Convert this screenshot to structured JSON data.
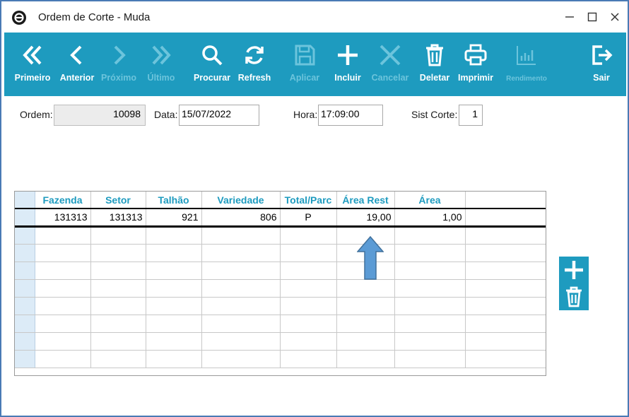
{
  "window": {
    "title": "Ordem de Corte - Muda",
    "controls": [
      "minimize-icon",
      "maximize-icon",
      "close-icon"
    ]
  },
  "toolbar": {
    "buttons": [
      {
        "label": "Primeiro",
        "icon": "first-icon",
        "enabled": true
      },
      {
        "label": "Anterior",
        "icon": "prev-icon",
        "enabled": true
      },
      {
        "label": "Próximo",
        "icon": "next-icon",
        "enabled": false
      },
      {
        "label": "Último",
        "icon": "last-icon",
        "enabled": false
      },
      {
        "label": "Procurar",
        "icon": "search-icon",
        "enabled": true
      },
      {
        "label": "Refresh",
        "icon": "refresh-icon",
        "enabled": true
      },
      {
        "label": "Aplicar",
        "icon": "save-icon",
        "enabled": false
      },
      {
        "label": "Incluir",
        "icon": "plus-icon",
        "enabled": true
      },
      {
        "label": "Cancelar",
        "icon": "cancel-icon",
        "enabled": false
      },
      {
        "label": "Deletar",
        "icon": "trash-icon",
        "enabled": true
      },
      {
        "label": "Imprimir",
        "icon": "print-icon",
        "enabled": true
      },
      {
        "label": "Rendimento",
        "icon": "chart-icon",
        "enabled": false
      },
      {
        "label": "Sair",
        "icon": "exit-icon",
        "enabled": true
      }
    ]
  },
  "form": {
    "ordem_label": "Ordem:",
    "ordem_value": "10098",
    "data_label": "Data:",
    "data_value": "15/07/2022",
    "hora_label": "Hora:",
    "hora_value": "17:09:00",
    "sist_label": "Sist Corte:",
    "sist_value": "1"
  },
  "grid": {
    "columns": [
      "Fazenda",
      "Setor",
      "Talhão",
      "Variedade",
      "Total/Parc",
      "Área Rest",
      "Área"
    ],
    "rows": [
      [
        "131313",
        "131313",
        "921",
        "806",
        "P",
        "19,00",
        "1,00"
      ]
    ],
    "empty_rows": 8
  },
  "side_actions": [
    {
      "icon": "plus-icon"
    },
    {
      "icon": "trash-icon"
    }
  ],
  "colors": {
    "accent": "#1e9bbf",
    "disabled_label": "#6cc4dc",
    "window_border": "#4a7ab5",
    "arrow_fill": "#5b9bd5"
  }
}
